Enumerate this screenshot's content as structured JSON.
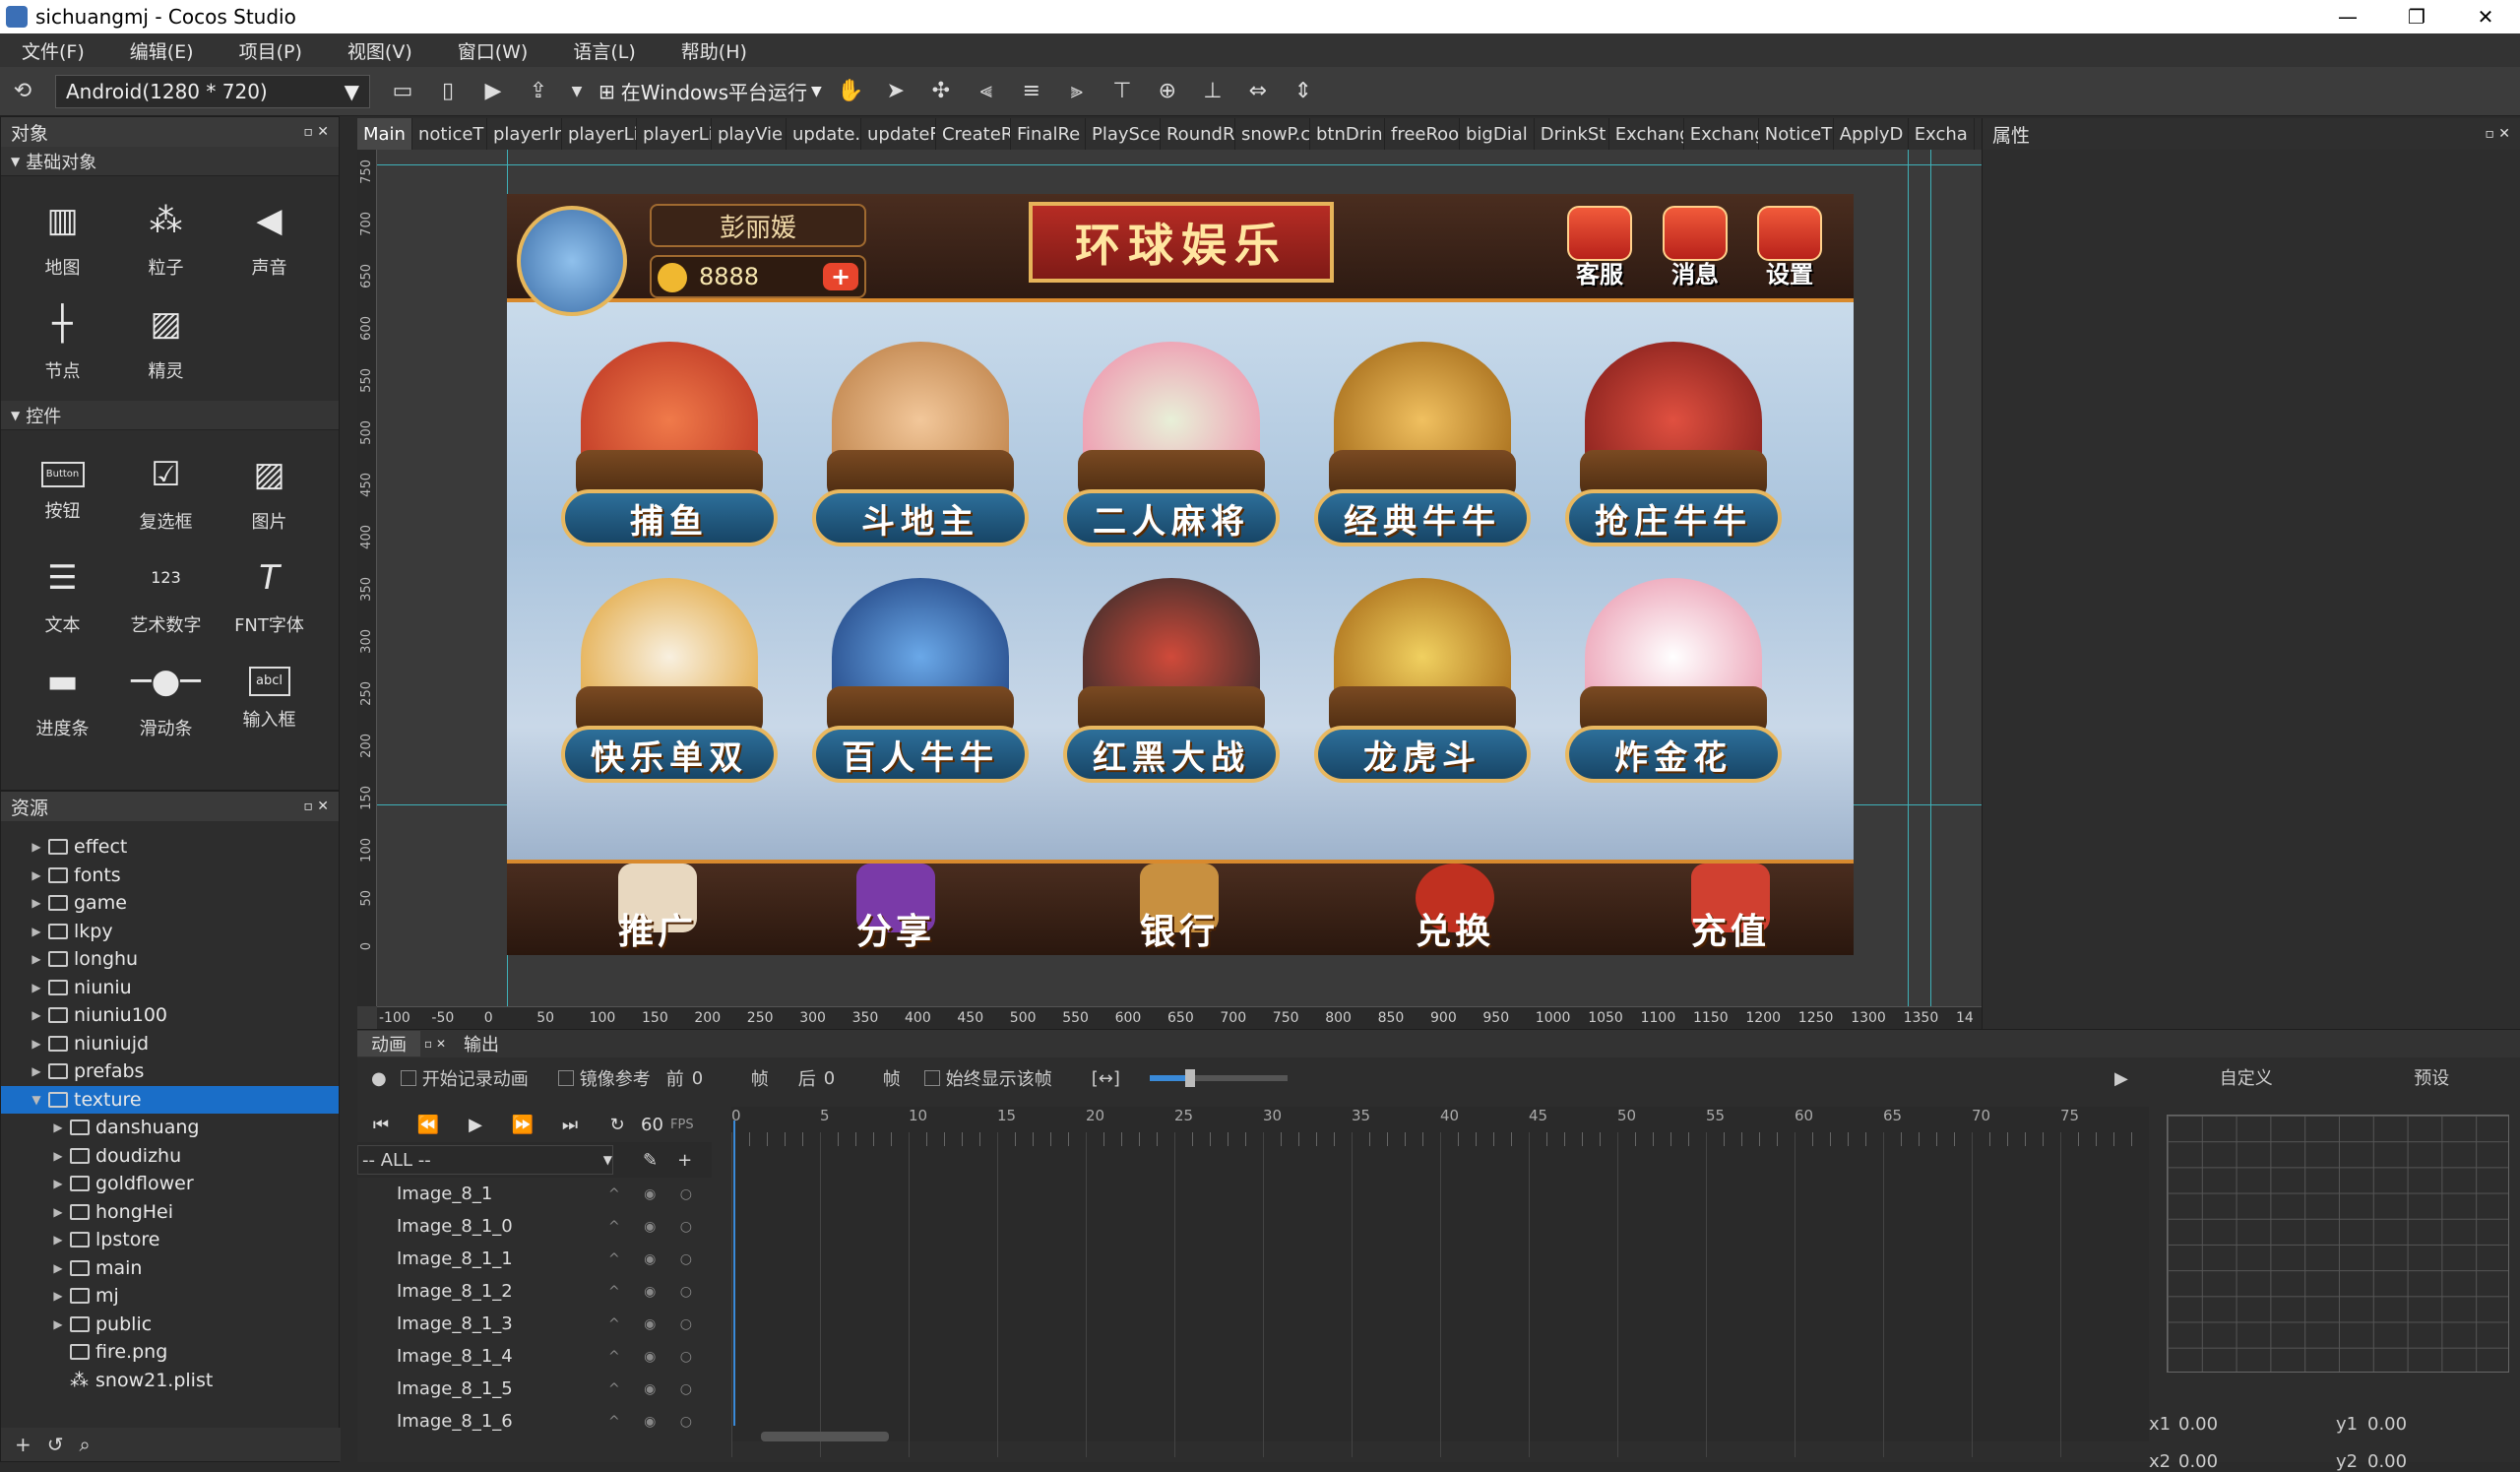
{
  "window": {
    "title": "sichuangmj - Cocos Studio",
    "minimize": "—",
    "restore": "❐",
    "close": "✕"
  },
  "menu": [
    "文件(F)",
    "编辑(E)",
    "项目(P)",
    "视图(V)",
    "窗口(W)",
    "语言(L)",
    "帮助(H)"
  ],
  "toolbar": {
    "resolution": "Android(1280 * 720)",
    "run_target": "在Windows平台运行"
  },
  "objects_panel": {
    "title": "对象",
    "basic_section": "基础对象",
    "basic_items": [
      {
        "label": "地图",
        "icon": "map-icon"
      },
      {
        "label": "粒子",
        "icon": "particle-icon"
      },
      {
        "label": "声音",
        "icon": "sound-icon"
      },
      {
        "label": "节点",
        "icon": "node-icon"
      },
      {
        "label": "精灵",
        "icon": "sprite-icon"
      }
    ],
    "controls_section": "控件",
    "control_items": [
      {
        "label": "按钮",
        "icon": "button-icon"
      },
      {
        "label": "复选框",
        "icon": "checkbox-icon"
      },
      {
        "label": "图片",
        "icon": "image-icon"
      },
      {
        "label": "文本",
        "icon": "text-icon"
      },
      {
        "label": "艺术数字",
        "icon": "art-number-icon"
      },
      {
        "label": "FNT字体",
        "icon": "fnt-font-icon"
      },
      {
        "label": "进度条",
        "icon": "progress-bar-icon"
      },
      {
        "label": "滑动条",
        "icon": "slider-icon"
      },
      {
        "label": "输入框",
        "icon": "input-box-icon"
      }
    ],
    "button_icon_text": "Button",
    "art_number_text": "123",
    "input_text": "abcl"
  },
  "resources_panel": {
    "title": "资源",
    "tree": [
      "effect",
      "fonts",
      "game",
      "lkpy",
      "longhu",
      "niuniu",
      "niuniu100",
      "niuniujd",
      "prefabs",
      "texture",
      "danshuang",
      "doudizhu",
      "goldflower",
      "hongHei",
      "lpstore",
      "main",
      "mj",
      "public",
      "fire.png",
      "snow21.plist"
    ]
  },
  "doc_tabs": [
    "Main",
    "noticeT",
    "playerIn",
    "playerLi",
    "playerLi",
    "playVie",
    "update.",
    "updateF",
    "CreateR",
    "FinalRe",
    "PlaySce",
    "RoundR",
    "snowP.c",
    "btnDrin",
    "freeRoo",
    "bigDial",
    "DrinkSt",
    "Exchang",
    "Exchang",
    "NoticeT",
    "ApplyD",
    "Excha"
  ],
  "scene": {
    "player_name": "彭丽媛",
    "coins": "8888",
    "plus": "+",
    "logo": "环球娱乐",
    "top_buttons": [
      "客服",
      "消息",
      "设置"
    ],
    "games": [
      "捕鱼",
      "斗地主",
      "二人麻将",
      "经典牛牛",
      "抢庄牛牛",
      "快乐单双",
      "百人牛牛",
      "红黑大战",
      "龙虎斗",
      "炸金花"
    ],
    "bottom_buttons": [
      "推广",
      "分享",
      "银行",
      "兑换",
      "充值"
    ]
  },
  "ruler_h": [
    "-100",
    "-50",
    "0",
    "50",
    "100",
    "150",
    "200",
    "250",
    "300",
    "350",
    "400",
    "450",
    "500",
    "550",
    "600",
    "650",
    "700",
    "750",
    "800",
    "850",
    "900",
    "950",
    "1000",
    "1050",
    "1100",
    "1150",
    "1200",
    "1250",
    "1300",
    "1350",
    "14"
  ],
  "ruler_v": [
    "750",
    "700",
    "650",
    "600",
    "550",
    "500",
    "450",
    "400",
    "350",
    "300",
    "250",
    "200",
    "150",
    "100",
    "50",
    "0"
  ],
  "props_panel": {
    "title": "属性"
  },
  "anim_panel": {
    "tabs": [
      "动画",
      "输出"
    ],
    "record_label": "开始记录动画",
    "mirror_label": "镜像参考",
    "before_label": "前",
    "before_value": "0",
    "after_label": "后",
    "after_value": "0",
    "frame_unit": "帧",
    "always_show_label": "始终显示该帧",
    "fps_value": "60",
    "fps_label": "FPS",
    "filter": "-- ALL --",
    "tick_labels": [
      "0",
      "5",
      "10",
      "15",
      "20",
      "25",
      "30",
      "35",
      "40",
      "45",
      "50",
      "55",
      "60",
      "65",
      "70",
      "75"
    ],
    "tracks": [
      "Image_8_1",
      "Image_8_1_0",
      "Image_8_1_1",
      "Image_8_1_2",
      "Image_8_1_3",
      "Image_8_1_4",
      "Image_8_1_5",
      "Image_8_1_6"
    ],
    "curve_tabs": [
      "自定义",
      "预设"
    ],
    "x1_label": "x1",
    "x1": "0.00",
    "y1_label": "y1",
    "y1": "0.00",
    "x2_label": "x2",
    "x2": "0.00",
    "y2_label": "y2",
    "y2": "0.00"
  }
}
